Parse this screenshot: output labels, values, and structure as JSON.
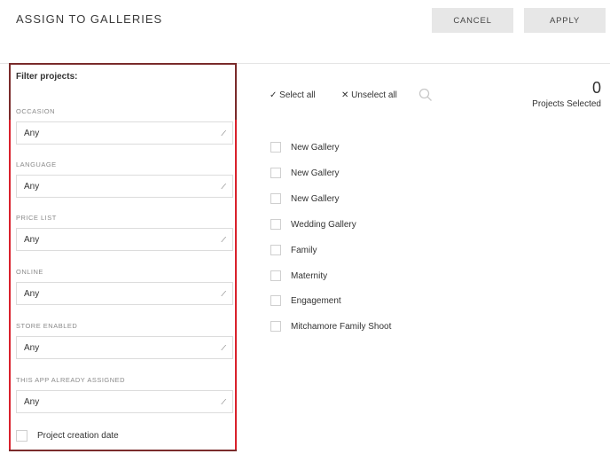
{
  "header": {
    "title": "ASSIGN TO GALLERIES",
    "cancel_label": "CANCEL",
    "apply_label": "APPLY"
  },
  "filters": {
    "heading": "Filter projects:",
    "fields": [
      {
        "label": "OCCASION",
        "value": "Any"
      },
      {
        "label": "LANGUAGE",
        "value": "Any"
      },
      {
        "label": "PRICE LIST",
        "value": "Any"
      },
      {
        "label": "ONLINE",
        "value": "Any"
      },
      {
        "label": "STORE ENABLED",
        "value": "Any"
      },
      {
        "label": "THIS APP ALREADY ASSIGNED",
        "value": "Any"
      }
    ],
    "date_label": "Project creation date"
  },
  "toolbar": {
    "select_all": "Select all",
    "unselect_all": "Unselect all",
    "check_icon": "check-icon",
    "x_icon": "close-icon",
    "search_icon": "search-icon"
  },
  "selection": {
    "count": "0",
    "label": "Projects Selected"
  },
  "galleries": [
    "New Gallery",
    "New Gallery",
    "New Gallery",
    "Wedding Gallery",
    "Family",
    "Maternity",
    "Engagement",
    "Mitchamore Family Shoot"
  ],
  "colors": {
    "panel_border": "#7a2b2b",
    "highlight": "#d9212c",
    "button_bg": "#e7e7e7"
  }
}
